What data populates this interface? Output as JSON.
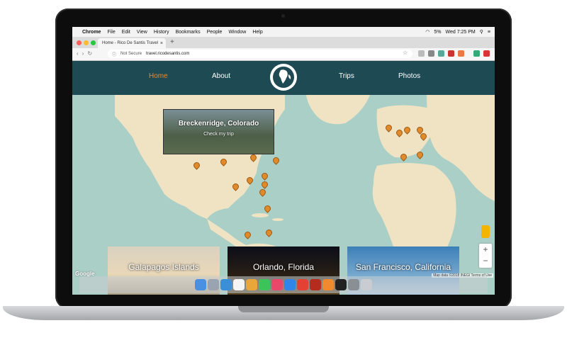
{
  "menubar": {
    "app": "Chrome",
    "items": [
      "File",
      "Edit",
      "View",
      "History",
      "Bookmarks",
      "People",
      "Window",
      "Help"
    ],
    "battery": "5%",
    "clock": "Wed 7:25 PM"
  },
  "browser": {
    "tab_title": "Home - Rico De Santis Travel",
    "new_tab": "+",
    "not_secure": "Not Secure",
    "url": "travel.ricodesantis.com",
    "nav_glyphs": "‹›↻"
  },
  "site": {
    "nav": {
      "home": "Home",
      "about": "About",
      "trips": "Trips",
      "photos": "Photos"
    },
    "popup": {
      "title": "Breckenridge, Colorado",
      "link": "Check my trip"
    },
    "cards": [
      {
        "label": "Galapagos Islands"
      },
      {
        "label": "Orlando, Florida"
      },
      {
        "label": "San Francisco, California"
      }
    ],
    "zoom_in": "+",
    "zoom_out": "−",
    "map_attribution": "Google",
    "map_terms": "Map data ©2018 INEGI  Terms of Use"
  },
  "dock_icons": [
    "finder-icon",
    "launchpad-icon",
    "safari-icon",
    "calendar-icon",
    "photos-icon",
    "messages-icon",
    "music-icon",
    "app-store-icon",
    "chrome-icon",
    "filezilla-icon",
    "sublime-icon",
    "terminal-icon",
    "preferences-icon",
    "trash-icon"
  ],
  "colors": {
    "nav_bg": "#1e4a53",
    "accent": "#e88a2e",
    "pin": "#e08a2c",
    "map_water": "#aacfc6",
    "map_land": "#efe3c4"
  }
}
